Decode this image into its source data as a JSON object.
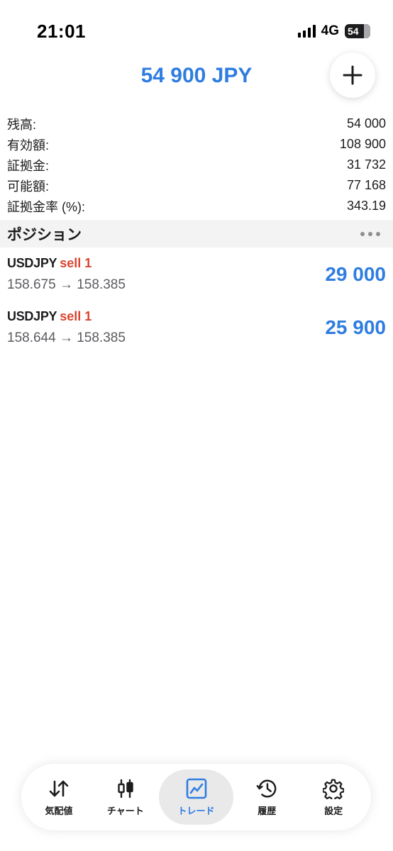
{
  "status_bar": {
    "time": "21:01",
    "network": "4G",
    "battery": "54"
  },
  "header": {
    "equity": "54 900 JPY"
  },
  "summary": [
    {
      "label": "残高:",
      "value": "54 000"
    },
    {
      "label": "有効額:",
      "value": "108 900"
    },
    {
      "label": "証拠金:",
      "value": "31 732"
    },
    {
      "label": "可能額:",
      "value": "77 168"
    },
    {
      "label": "証拠金率 (%):",
      "value": "343.19"
    }
  ],
  "positions_section": {
    "title": "ポジション"
  },
  "positions": [
    {
      "symbol": "USDJPY",
      "side": "sell 1",
      "prices": "158.675 → 158.385",
      "profit": "29 000"
    },
    {
      "symbol": "USDJPY",
      "side": "sell 1",
      "prices": "158.644 → 158.385",
      "profit": "25 900"
    }
  ],
  "nav": [
    {
      "label": "気配値",
      "icon": "quotes-arrows-icon"
    },
    {
      "label": "チャート",
      "icon": "candlestick-chart-icon"
    },
    {
      "label": "トレード",
      "icon": "trade-chart-icon",
      "active": true
    },
    {
      "label": "履歴",
      "icon": "history-icon"
    },
    {
      "label": "設定",
      "icon": "settings-gear-icon"
    }
  ],
  "colors": {
    "accent": "#2f7de1",
    "sell": "#d9432f",
    "nav_active_bg": "#e9e9ea"
  }
}
